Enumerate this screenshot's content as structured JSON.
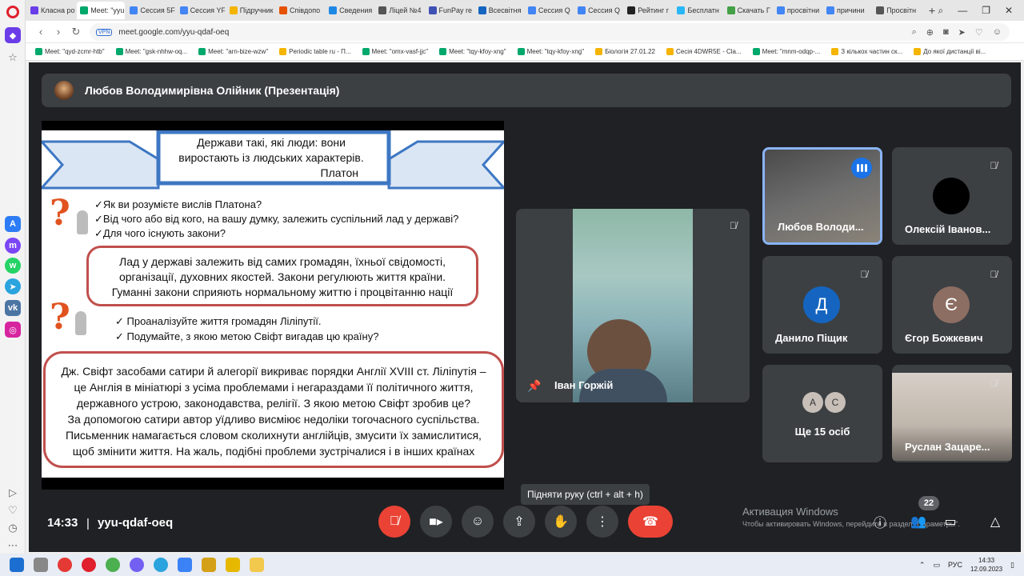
{
  "browser": {
    "tabs": [
      {
        "label": "Класна ро",
        "color": "#6a3de8"
      },
      {
        "label": "Meet: \"yyu",
        "color": "#00a86b",
        "active": true
      },
      {
        "label": "Сессия 5F",
        "color": "#4285f4"
      },
      {
        "label": "Сессия YF",
        "color": "#4285f4"
      },
      {
        "label": "Підручник",
        "color": "#f4b400"
      },
      {
        "label": "Співдопо",
        "color": "#e65100"
      },
      {
        "label": "Сведения",
        "color": "#1e88e5"
      },
      {
        "label": "Ліцей №4",
        "color": "#555555"
      },
      {
        "label": "FunPay re",
        "color": "#3f51b5"
      },
      {
        "label": "Всесвітня",
        "color": "#1565c0"
      },
      {
        "label": "Сессия Q",
        "color": "#4285f4"
      },
      {
        "label": "Сессия Q",
        "color": "#4285f4"
      },
      {
        "label": "Рейтинг г",
        "color": "#212121"
      },
      {
        "label": "Бесплатн",
        "color": "#29b6f6"
      },
      {
        "label": "Скачать Г",
        "color": "#43a047"
      },
      {
        "label": "просвітни",
        "color": "#4285f4"
      },
      {
        "label": "причини",
        "color": "#4285f4"
      },
      {
        "label": "Просвітн",
        "color": "#555555"
      }
    ],
    "new_tab": "+",
    "vpn_label": "VPN",
    "url": "meet.google.com/yyu-qdaf-oeq",
    "bookmarks": [
      "Meet: \"qyd-zcmr-htb\"",
      "Meet: \"gsk-nhhw-oq...",
      "Meet: \"arn-bize-wzw\"",
      "Periodic table ru - П...",
      "Meet: \"omx-vasf-jjc\"",
      "Meet: \"tqy-kfoy-xng\"",
      "Meet: \"tqy-kfoy-xng\"",
      "Біологія 27.01.22",
      "Сесія 4DWR5E - Cla...",
      "Meet: \"mnm-odqp-...",
      "З кількох частин ск...",
      "До якої дистанції ві..."
    ]
  },
  "meet": {
    "presenter_title": "Любов Володимирівна Олійник (Презентація)",
    "slide": {
      "quote_lines": [
        "Держави такі, які люди: вони",
        "виростають із людських характерів."
      ],
      "quote_author": "Платон",
      "questions1": [
        "✓Як ви розумієте вислів Платона?",
        "✓Від чого або від кого, на вашу думку, залежить суспільний лад у державі?",
        "✓Для чого існують закони?"
      ],
      "answer1": [
        "Лад у державі залежить від самих громадян, їхньої свідомості,",
        "організації, духовних якостей. Закони регулюють життя країни.",
        "Гуманні закони сприяють нормальному життю і процвітанню нації"
      ],
      "questions2": [
        "✓ Проаналізуйте життя громадян Ліліпутії.",
        "✓ Подумайте, з якою метою Свіфт вигадав цю країну?"
      ],
      "answer2": [
        "Дж. Свіфт засобами сатири й алегорії викриває порядки Англії XVIII ст. Ліліпутія –",
        "це Англія в мініатюрі з усіма проблемами і негараздами її політичного життя,",
        "державного устрою, законодавства, релігії. З якою метою Свіфт зробив це?",
        "За допомогою сатири автор уїдливо висміює недоліки тогочасного суспільства.",
        "Письменник намагається словом сколихнути англійців, змусити їх замислитися,",
        "щоб змінити життя. На жаль, подібні проблеми зустрічалися і в інших країнах"
      ]
    },
    "pinned": {
      "name": "Іван Горжій"
    },
    "participants": [
      {
        "name": "Любов Володи...",
        "speaking": true
      },
      {
        "name": "Олексій Іванов..."
      },
      {
        "name": "Данило Піщик",
        "initial": "Д",
        "color": "#1565c0"
      },
      {
        "name": "Єгор Божкевич",
        "initial": "Є",
        "color": "#8d6e63"
      },
      {
        "more_label": "Ще 15 осіб",
        "initials": [
          "А",
          "С"
        ]
      },
      {
        "name": "Руслан Зацаре..."
      }
    ],
    "tooltip": "Підняти руку (ctrl + alt + h)",
    "time": "14:33",
    "separator": "|",
    "meeting_code": "yyu-qdaf-oeq",
    "participant_count": "22",
    "watermark_title": "Активация Windows",
    "watermark_sub": "Чтобы активировать Windows, перейдите в раздел \"Параметры\"."
  },
  "taskbar": {
    "lang": "РУС",
    "time": "14:33",
    "date": "12.09.2023"
  },
  "icons": {
    "mic_off": "mic-off-icon",
    "camera": "camera-icon",
    "emoji": "emoji-icon",
    "present": "present-icon",
    "hand": "raise-hand-icon",
    "more": "more-options-icon",
    "hangup": "hangup-icon",
    "info": "info-icon",
    "people": "people-icon",
    "activities": "activities-icon",
    "pin": "pin-icon"
  }
}
